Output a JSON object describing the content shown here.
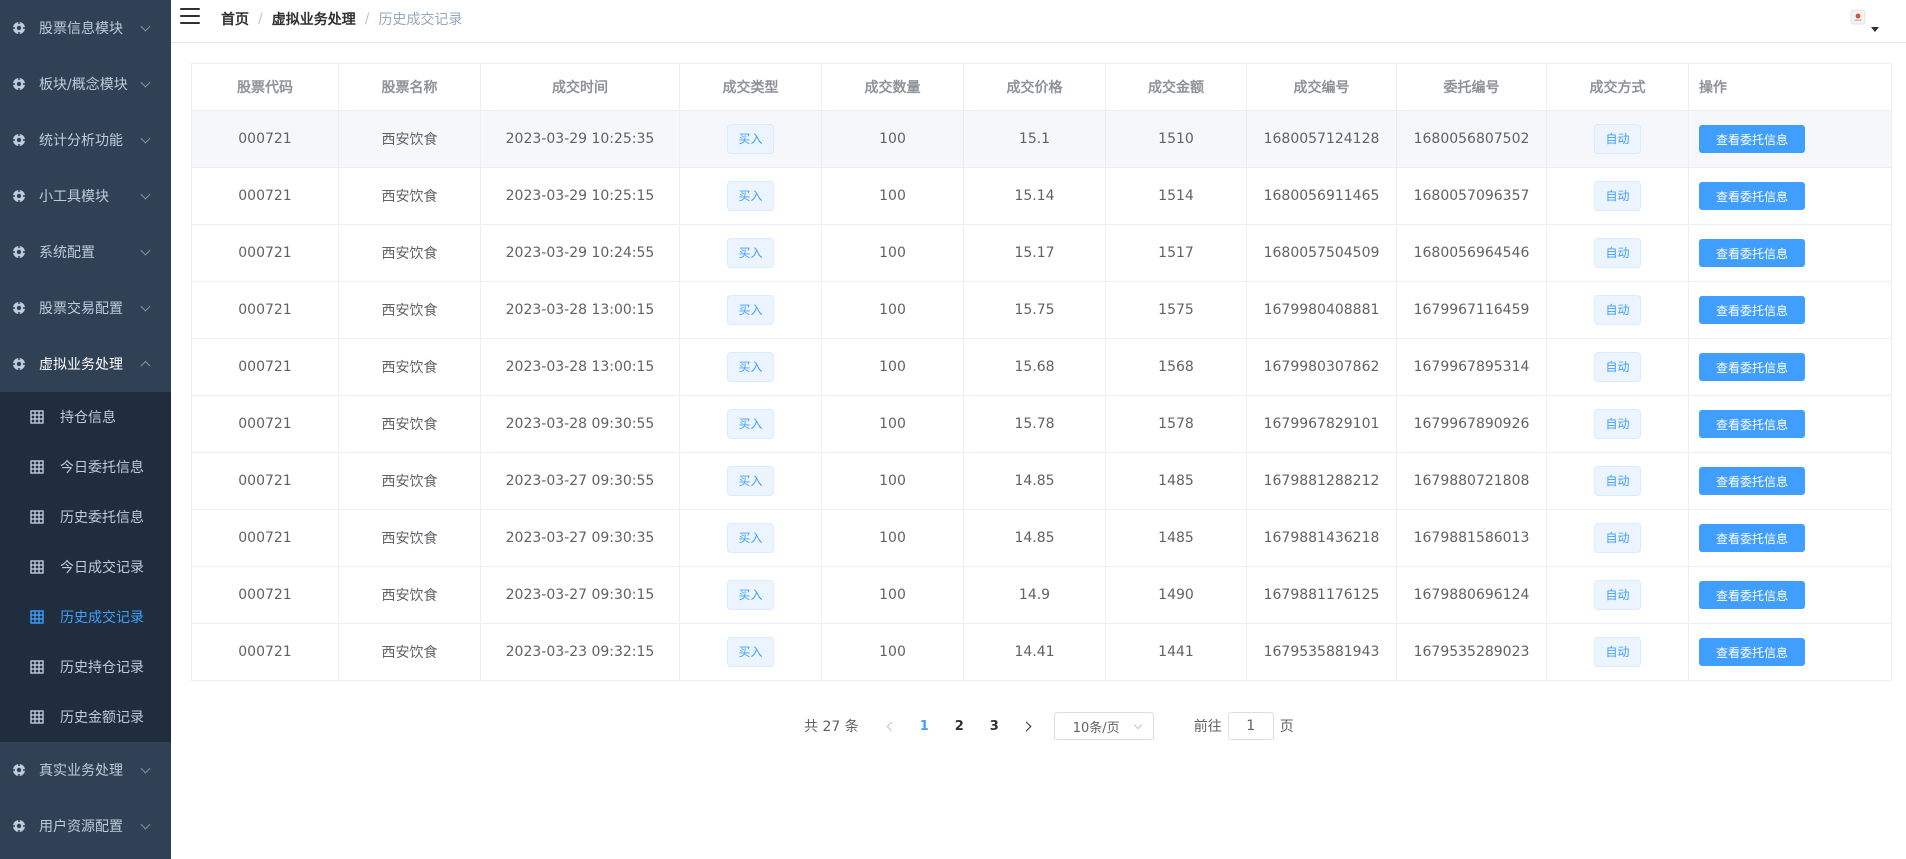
{
  "sidebar": {
    "top_items": [
      {
        "label": "股票信息模块"
      },
      {
        "label": "板块/概念模块"
      },
      {
        "label": "统计分析功能"
      },
      {
        "label": "小工具模块"
      },
      {
        "label": "系统配置"
      },
      {
        "label": "股票交易配置"
      },
      {
        "label": "虚拟业务处理"
      }
    ],
    "sub_items": [
      {
        "label": "持仓信息"
      },
      {
        "label": "今日委托信息"
      },
      {
        "label": "历史委托信息"
      },
      {
        "label": "今日成交记录"
      },
      {
        "label": "历史成交记录"
      },
      {
        "label": "历史持仓记录"
      },
      {
        "label": "历史金额记录"
      }
    ],
    "bottom_items": [
      {
        "label": "真实业务处理"
      },
      {
        "label": "用户资源配置"
      }
    ],
    "active_sub": "历史成交记录",
    "colors": {
      "bg": "#304156",
      "submenu_bg": "#1f2d3d",
      "text": "#bfcbd9",
      "active": "#409eff"
    }
  },
  "header": {
    "breadcrumb": [
      {
        "label": "首页"
      },
      {
        "label": "虚拟业务处理"
      },
      {
        "label": "历史成交记录"
      }
    ],
    "separator": "/"
  },
  "table": {
    "columns": [
      "股票代码",
      "股票名称",
      "成交时间",
      "成交类型",
      "成交数量",
      "成交价格",
      "成交金额",
      "成交编号",
      "委托编号",
      "成交方式",
      "操作"
    ],
    "rows": [
      {
        "code": "000721",
        "name": "西安饮食",
        "time": "2023-03-29 10:25:35",
        "type": "买入",
        "qty": "100",
        "price": "15.1",
        "amount": "1510",
        "deal_no": "1680057124128",
        "order_no": "1680056807502",
        "mode": "自动",
        "action": "查看委托信息"
      },
      {
        "code": "000721",
        "name": "西安饮食",
        "time": "2023-03-29 10:25:15",
        "type": "买入",
        "qty": "100",
        "price": "15.14",
        "amount": "1514",
        "deal_no": "1680056911465",
        "order_no": "1680057096357",
        "mode": "自动",
        "action": "查看委托信息"
      },
      {
        "code": "000721",
        "name": "西安饮食",
        "time": "2023-03-29 10:24:55",
        "type": "买入",
        "qty": "100",
        "price": "15.17",
        "amount": "1517",
        "deal_no": "1680057504509",
        "order_no": "1680056964546",
        "mode": "自动",
        "action": "查看委托信息"
      },
      {
        "code": "000721",
        "name": "西安饮食",
        "time": "2023-03-28 13:00:15",
        "type": "买入",
        "qty": "100",
        "price": "15.75",
        "amount": "1575",
        "deal_no": "1679980408881",
        "order_no": "1679967116459",
        "mode": "自动",
        "action": "查看委托信息"
      },
      {
        "code": "000721",
        "name": "西安饮食",
        "time": "2023-03-28 13:00:15",
        "type": "买入",
        "qty": "100",
        "price": "15.68",
        "amount": "1568",
        "deal_no": "1679980307862",
        "order_no": "1679967895314",
        "mode": "自动",
        "action": "查看委托信息"
      },
      {
        "code": "000721",
        "name": "西安饮食",
        "time": "2023-03-28 09:30:55",
        "type": "买入",
        "qty": "100",
        "price": "15.78",
        "amount": "1578",
        "deal_no": "1679967829101",
        "order_no": "1679967890926",
        "mode": "自动",
        "action": "查看委托信息"
      },
      {
        "code": "000721",
        "name": "西安饮食",
        "time": "2023-03-27 09:30:55",
        "type": "买入",
        "qty": "100",
        "price": "14.85",
        "amount": "1485",
        "deal_no": "1679881288212",
        "order_no": "1679880721808",
        "mode": "自动",
        "action": "查看委托信息"
      },
      {
        "code": "000721",
        "name": "西安饮食",
        "time": "2023-03-27 09:30:35",
        "type": "买入",
        "qty": "100",
        "price": "14.85",
        "amount": "1485",
        "deal_no": "1679881436218",
        "order_no": "1679881586013",
        "mode": "自动",
        "action": "查看委托信息"
      },
      {
        "code": "000721",
        "name": "西安饮食",
        "time": "2023-03-27 09:30:15",
        "type": "买入",
        "qty": "100",
        "price": "14.9",
        "amount": "1490",
        "deal_no": "1679881176125",
        "order_no": "1679880696124",
        "mode": "自动",
        "action": "查看委托信息"
      },
      {
        "code": "000721",
        "name": "西安饮食",
        "time": "2023-03-23 09:32:15",
        "type": "买入",
        "qty": "100",
        "price": "14.41",
        "amount": "1441",
        "deal_no": "1679535881943",
        "order_no": "1679535289023",
        "mode": "自动",
        "action": "查看委托信息"
      }
    ]
  },
  "pagination": {
    "total_text": "共 27 条",
    "pages": [
      "1",
      "2",
      "3"
    ],
    "current_page": "1",
    "page_size": "10条/页",
    "goto_label": "前往",
    "goto_value": "1",
    "page_suffix": "页"
  },
  "colors": {
    "primary": "#409eff",
    "border": "#ebeef5",
    "header_text": "#909399"
  }
}
